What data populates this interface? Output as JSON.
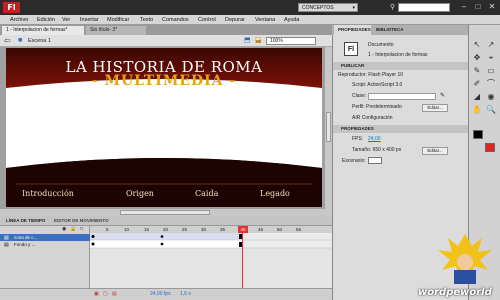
{
  "app": {
    "logo": "Fl",
    "workspace": "CONCEPTOS BÁSICOS"
  },
  "menu": [
    "Archivo",
    "Edición",
    "Ver",
    "Insertar",
    "Modificar",
    "Texto",
    "Comandos",
    "Control",
    "Depurar",
    "Ventana",
    "Ayuda"
  ],
  "doc_tabs": [
    "1 - Interpolacion de formas*",
    "Sin título- 2*"
  ],
  "editbar": {
    "scene": "Escena 1",
    "zoom": "100%"
  },
  "stage": {
    "title": "LA HISTORIA DE ROMA",
    "subtitle": "- MULTIMEDIA -",
    "nav": [
      "Introducción",
      "Origen",
      "Caida",
      "Legado"
    ],
    "colors": {
      "bg": "#1d0402",
      "accent": "#e8a21a",
      "band": "#ffffff",
      "header": "#5c0a04"
    }
  },
  "timeline": {
    "tabs": [
      "LÍNEA DE TIEMPO",
      "EDITOR DE MOVIMIENTO"
    ],
    "layers": [
      "zona de c...",
      "Fondo y ..."
    ],
    "ruler": [
      "5",
      "10",
      "15",
      "20",
      "25",
      "30",
      "35",
      "40",
      "45",
      "50",
      "55"
    ],
    "current_frame": "40",
    "footer": {
      "fps": "24,00 fps",
      "time": "1,6 s"
    }
  },
  "properties": {
    "tabs": [
      "PROPIEDADES",
      "BIBLIOTECA"
    ],
    "doc_label": "Documento",
    "doc_name": "1 - Interpolacion de formas",
    "publish": {
      "header": "PUBLICAR",
      "player": "Reproductor: Flash Player 10",
      "script": "Script: ActionScript 3.0",
      "class_label": "Clase:",
      "profile": "Perfil: Predeterminado",
      "air": "AIR  Configuración",
      "edit": "Editar..."
    },
    "props": {
      "header": "PROPIEDADES",
      "fps_label": "FPS:",
      "fps_value": "24,00",
      "size": "Tamaño:  650 x 400 px",
      "stage_label": "Escenario:",
      "edit": "Editar..."
    }
  },
  "tools": [
    "↖",
    "↗",
    "✥",
    "⌖",
    "✎",
    "▭",
    "✐",
    "⌒",
    "◢",
    "◉",
    "✋",
    "🔍"
  ],
  "watermark": "wordpeworld"
}
